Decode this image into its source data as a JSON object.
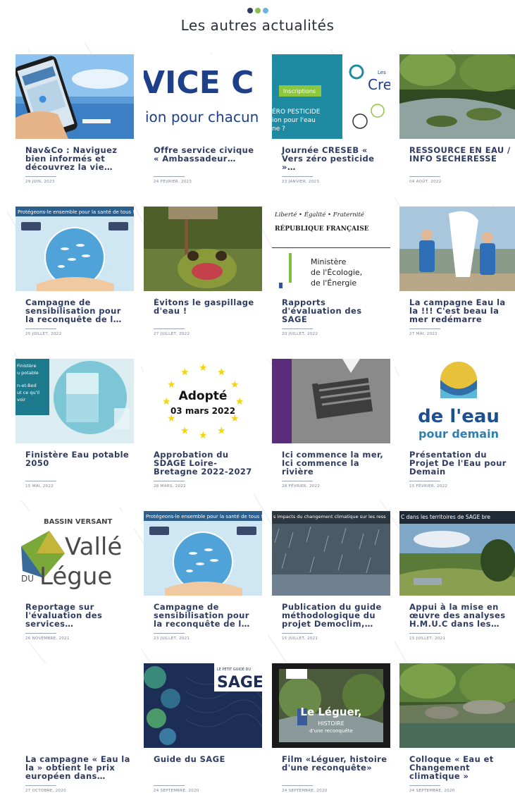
{
  "header": {
    "title": "Les autres actualités",
    "dot_colors": [
      "#2e3b63",
      "#8ac04a",
      "#6fb2e0"
    ]
  },
  "cards": [
    {
      "title": "Nav&Co : Naviguez bien informés et découvrez la vie…",
      "date": "29 JUIN, 2023",
      "thumb": "phone-beach"
    },
    {
      "title": "Offre service civique « Ambassadeur…",
      "date": "24 FÉVRIER, 2023",
      "thumb": "service-civique",
      "thumb_text_1": "VICE C",
      "thumb_text_2": "ion pour chacun"
    },
    {
      "title": "Journée CRESEB « Vers zéro pesticide »…",
      "date": "23 JANVIER, 2023",
      "thumb": "creseb",
      "thumb_text_1": "Inscriptions",
      "thumb_text_2": "ÉRO PESTICIDE",
      "thumb_text_3": "ion pour l'eau",
      "thumb_text_4": "ne ?",
      "thumb_text_5": "Les",
      "thumb_text_6": "Cre"
    },
    {
      "title": "RESSOURCE EN EAU / INFO SECHERESSE",
      "date": "04 AOÛT, 2022",
      "thumb": "river-forest"
    },
    {
      "title": "Campagne de sensibilisation pour la reconquête de l…",
      "date": "25 JUILLET, 2022",
      "thumb": "campaign-fish",
      "thumb_text_1": "Protégeons-le ensemble pour la santé de tous !"
    },
    {
      "title": "Évitons le gaspillage d'eau !",
      "date": "27 JUILLET, 2022",
      "thumb": "frog"
    },
    {
      "title": "Rapports d'évaluation des SAGE",
      "date": "20 JUILLET, 2022",
      "thumb": "republique",
      "thumb_text_1": "Liberté • Égalité • Fraternité",
      "thumb_text_2": "RÉPUBLIQUE FRANÇAISE",
      "thumb_text_3": "Ministère",
      "thumb_text_4": "de l'Écologie,",
      "thumb_text_5": "de l'Énergie"
    },
    {
      "title": "La campagne Eau la la !!! C'est beau la mer redémarre",
      "date": "27 MAI, 2022",
      "thumb": "people-beach"
    },
    {
      "title": "Finistère Eau potable 2050",
      "date": "15 MAI, 2022",
      "thumb": "glass-water",
      "thumb_text_1": "Finistère",
      "thumb_text_2": "u potable",
      "thumb_text_3": "n-et-Bed",
      "thumb_text_4": "ut ce qu'il",
      "thumb_text_5": "voir"
    },
    {
      "title": "Approbation du SDAGE Loire-Bretagne 2022-2027",
      "date": "28 MARS, 2022",
      "thumb": "adopte",
      "thumb_text_1": "Adopté",
      "thumb_text_2": "03 mars 2022"
    },
    {
      "title": "Ici commence la mer, Ici commence la rivière",
      "date": "28 FÉVRIER, 2022",
      "thumb": "drain"
    },
    {
      "title": "Présentation du Projet De l'Eau pour Demain",
      "date": "15 FÉVRIER, 2022",
      "thumb": "eau-demain",
      "thumb_text_1": "de l'eau",
      "thumb_text_2": "pour demain"
    },
    {
      "title": "Reportage sur l'évaluation des services…",
      "date": "26 NOVEMBRE, 2021",
      "thumb": "vallee-legue",
      "thumb_text_1": "BASSIN VERSANT",
      "thumb_text_2": "Vallé",
      "thumb_text_3": "DU",
      "thumb_text_4": "Légue"
    },
    {
      "title": "Campagne de sensibilisation pour la reconquête de l…",
      "date": "23 JUILLET, 2021",
      "thumb": "campaign-fish",
      "thumb_text_1": "Protégeons-le ensemble pour la santé de tous !"
    },
    {
      "title": "Publication du guide méthodologique du projet Democlim,…",
      "date": "15 JUILLET, 2021",
      "thumb": "rain",
      "thumb_text_1": "s impacts du changement climatique sur les ress"
    },
    {
      "title": "Appui à la mise en œuvre des analyses H.M.U.C dans les…",
      "date": "15 JUILLET, 2021",
      "thumb": "valley-sky",
      "thumb_text_1": "C dans les territoires de SAGE bre"
    },
    {
      "title": "La campagne « Eau la la » obtient le prix européen dans…",
      "date": "27 OCTOBRE, 2020",
      "thumb": "empty"
    },
    {
      "title": "Guide du SAGE",
      "date": "24 SEPTEMBRE, 2020",
      "thumb": "guide-sage",
      "thumb_text_1": "LE PETIT GUIDE DU",
      "thumb_text_2": "SAGE"
    },
    {
      "title": "Film «Léguer, histoire d'une reconquête»",
      "date": "24 SEPTEMBRE, 2020",
      "thumb": "film-leguer",
      "thumb_text_1": "Le Léguer,",
      "thumb_text_2": "HISTOIRE",
      "thumb_text_3": "d'une reconquête"
    },
    {
      "title": "Colloque « Eau et Changement climatique »",
      "date": "24 SEPTEMBRE, 2020",
      "thumb": "river-rocks"
    }
  ]
}
